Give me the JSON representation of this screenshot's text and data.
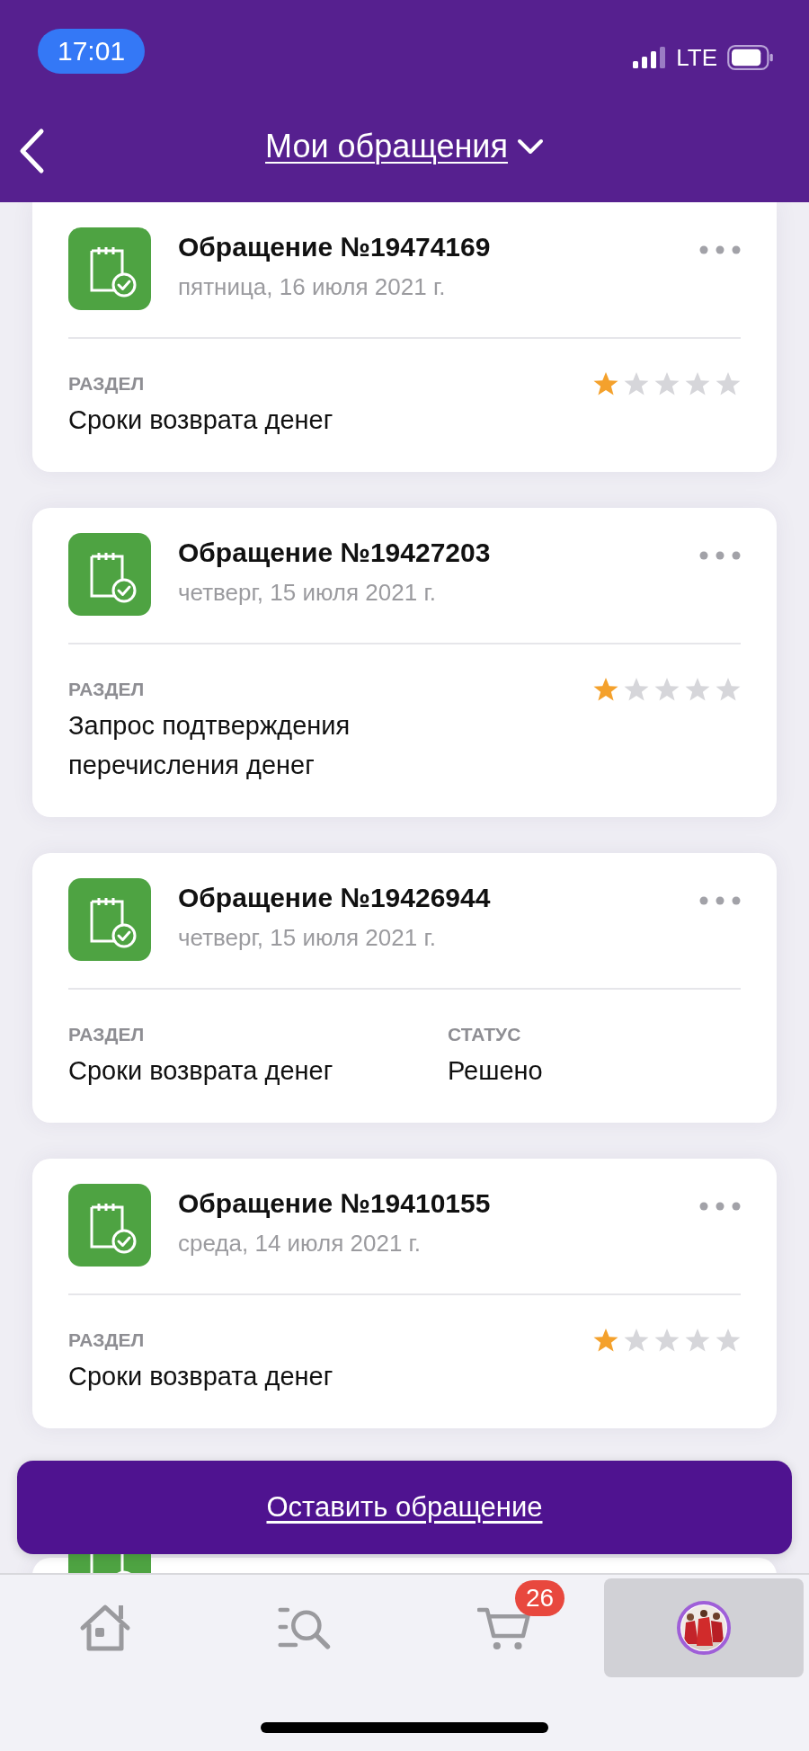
{
  "status_bar": {
    "time": "17:01",
    "network": "LTE"
  },
  "header": {
    "title": "Мои обращения"
  },
  "cards": [
    {
      "kind": "ticket",
      "title": "Обращение №19474169",
      "date": "пятница, 16 июля 2021 г.",
      "fields": [
        {
          "label": "РАЗДЕЛ",
          "value": "Сроки возврата денег"
        }
      ],
      "stars": 1
    },
    {
      "kind": "ticket",
      "title": "Обращение №19427203",
      "date": "четверг, 15 июля 2021 г.",
      "fields": [
        {
          "label": "РАЗДЕЛ",
          "value": "Запрос подтверждения перечисления денег"
        }
      ],
      "stars": 1
    },
    {
      "kind": "ticket",
      "title": "Обращение №19426944",
      "date": "четверг, 15 июля 2021 г.",
      "fields": [
        {
          "label": "РАЗДЕЛ",
          "value": "Сроки возврата денег"
        },
        {
          "label": "СТАТУС",
          "value": "Решено"
        }
      ]
    },
    {
      "kind": "ticket",
      "title": "Обращение №19410155",
      "date": "среда, 14 июля 2021 г.",
      "fields": [
        {
          "label": "РАЗДЕЛ",
          "value": "Сроки возврата денег"
        }
      ],
      "stars": 1
    },
    {
      "kind": "partial"
    }
  ],
  "action_button": {
    "label": "Оставить обращение"
  },
  "tab_bar": [
    {
      "kind": "home",
      "selected": false
    },
    {
      "kind": "search",
      "selected": false
    },
    {
      "kind": "cart",
      "selected": false,
      "badge": "26"
    },
    {
      "kind": "profile",
      "selected": true
    }
  ]
}
